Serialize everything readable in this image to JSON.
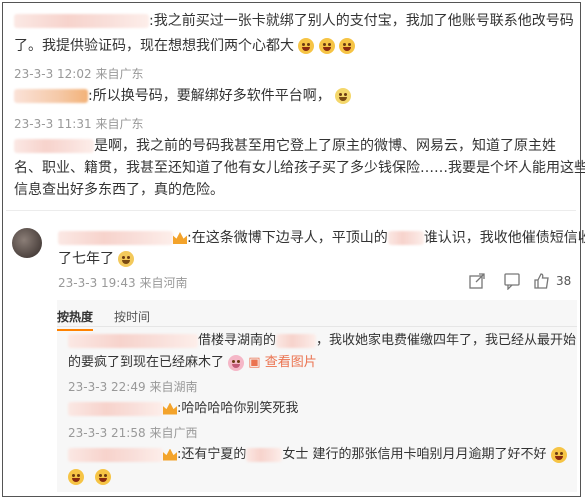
{
  "comment1": {
    "line1": ":我之前买过一张卡就绑了别人的支付宝，我加了他账号联系他改号码",
    "line2": "了。我提供验证码，现在想想我们两个心都大",
    "time": "23-3-3 12:02",
    "location": "来自广东"
  },
  "comment2": {
    "text": ":所以换号码，要解绑好多软件平台啊，",
    "time": "23-3-3 11:31",
    "location": "来自广东"
  },
  "comment3": {
    "line1": "是啊，我之前的号码我甚至用它登上了原主的微博、网易云，知道了原主姓",
    "line2": "名、职业、籍贯，我甚至还知道了他有女儿给孩子买了多少钱保险……我要是个坏人能用这些",
    "line3": "信息查出好多东西了，真的危险。"
  },
  "main_comment": {
    "line1": ":在这条微博下边寻人，平顶山的",
    "line1b": "谁认识，我收他催债短信收",
    "line2": "了七年了",
    "time": "23-3-3 19:43",
    "location": "来自河南",
    "like_count": "38"
  },
  "tabs": {
    "hot": "按热度",
    "time": "按时间"
  },
  "reply1": {
    "line1a": "借楼寻湖南的",
    "line1b": "，我收她家电费催缴四年了，我已经从最开始",
    "line2": "的要疯了到现在已经麻木了",
    "view_image": "查看图片",
    "time": "23-3-3 22:49",
    "location": "来自湖南"
  },
  "reply2": {
    "text": ":哈哈哈哈你别笑死我",
    "time": "23-3-3 21:58",
    "location": "来自广西"
  },
  "reply3": {
    "line1a": ":还有宁夏的",
    "line1b": "女士 建行的那张信用卡咱别月月逾期了好不好"
  }
}
